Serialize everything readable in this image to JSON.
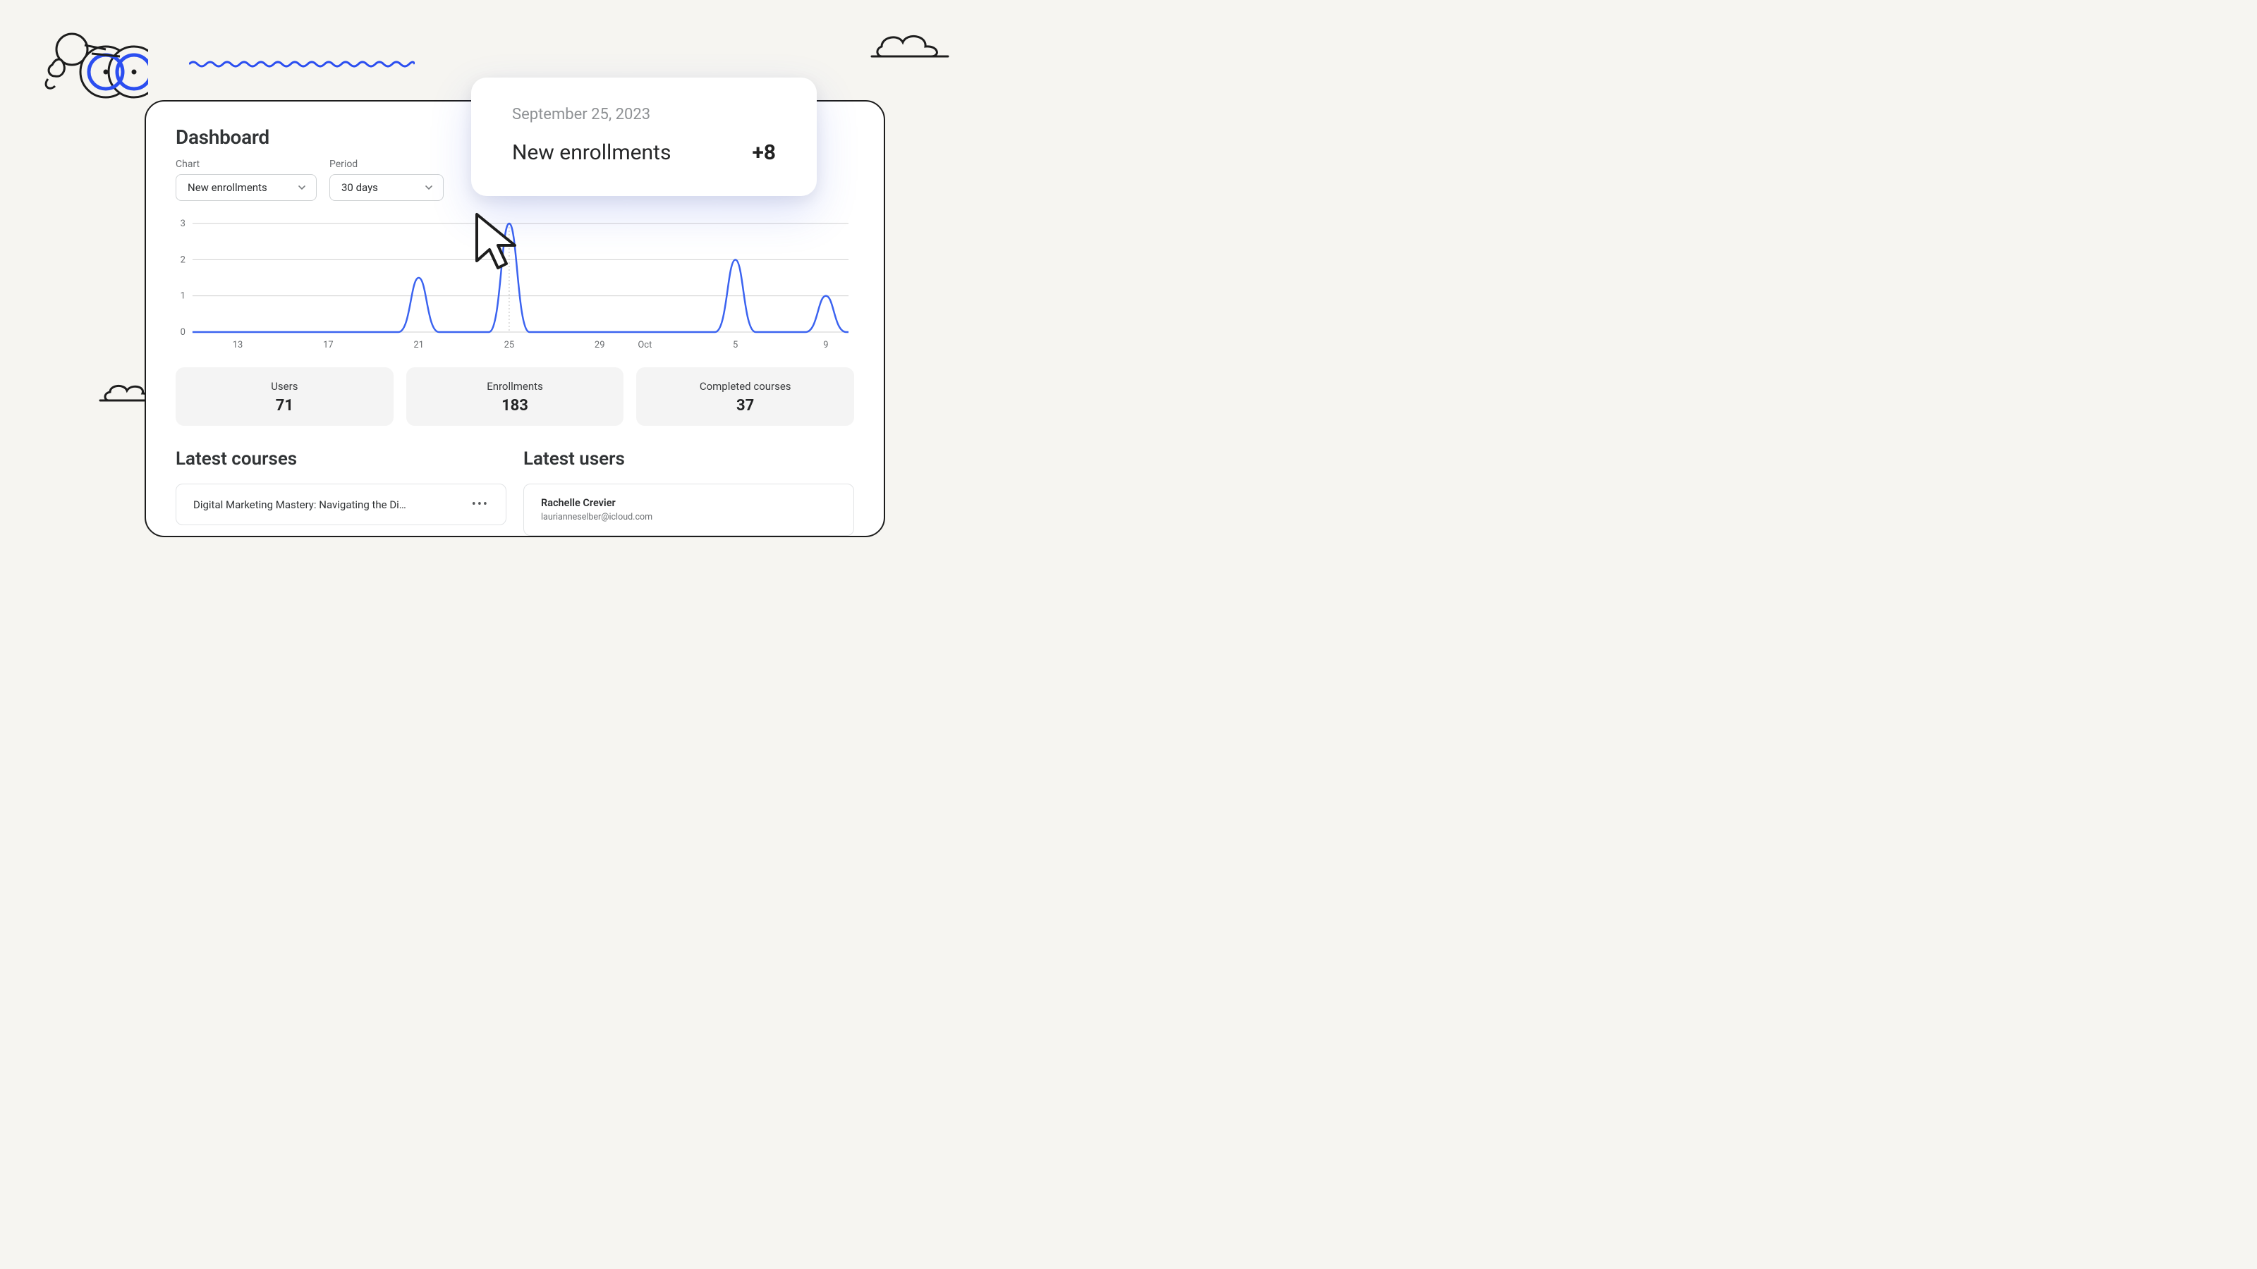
{
  "dashboard": {
    "title": "Dashboard",
    "controls": {
      "chart_label": "Chart",
      "chart_value": "New enrollments",
      "period_label": "Period",
      "period_value": "30 days"
    }
  },
  "tooltip": {
    "date": "September 25, 2023",
    "label": "New enrollments",
    "value": "+8"
  },
  "stats": [
    {
      "label": "Users",
      "value": "71"
    },
    {
      "label": "Enrollments",
      "value": "183"
    },
    {
      "label": "Completed courses",
      "value": "37"
    }
  ],
  "latest_courses": {
    "heading": "Latest courses",
    "items": [
      {
        "name": "Digital Marketing Mastery: Navigating the Di…"
      }
    ]
  },
  "latest_users": {
    "heading": "Latest users",
    "items": [
      {
        "name": "Rachelle Crevier",
        "email": "laurianneselber@icloud.com"
      }
    ]
  },
  "chart_data": {
    "type": "line",
    "title": "New enrollments",
    "xlabel": "",
    "ylabel": "",
    "ylim": [
      0,
      3
    ],
    "y_ticks": [
      0,
      1,
      2,
      3
    ],
    "x_tick_labels": [
      "13",
      "17",
      "21",
      "25",
      "29",
      "Oct",
      "5",
      "9"
    ],
    "x": [
      11,
      12,
      13,
      14,
      15,
      16,
      17,
      18,
      19,
      20,
      21,
      22,
      23,
      24,
      25,
      26,
      27,
      28,
      29,
      30,
      1,
      2,
      3,
      4,
      5,
      6,
      7,
      8,
      9,
      10
    ],
    "values": [
      0,
      0,
      0,
      0,
      0,
      0,
      0,
      0,
      0,
      0,
      1.5,
      0,
      0,
      0,
      3,
      0,
      0,
      0,
      0,
      0,
      0,
      0,
      0,
      0,
      2,
      0,
      0,
      0,
      1,
      0
    ]
  }
}
